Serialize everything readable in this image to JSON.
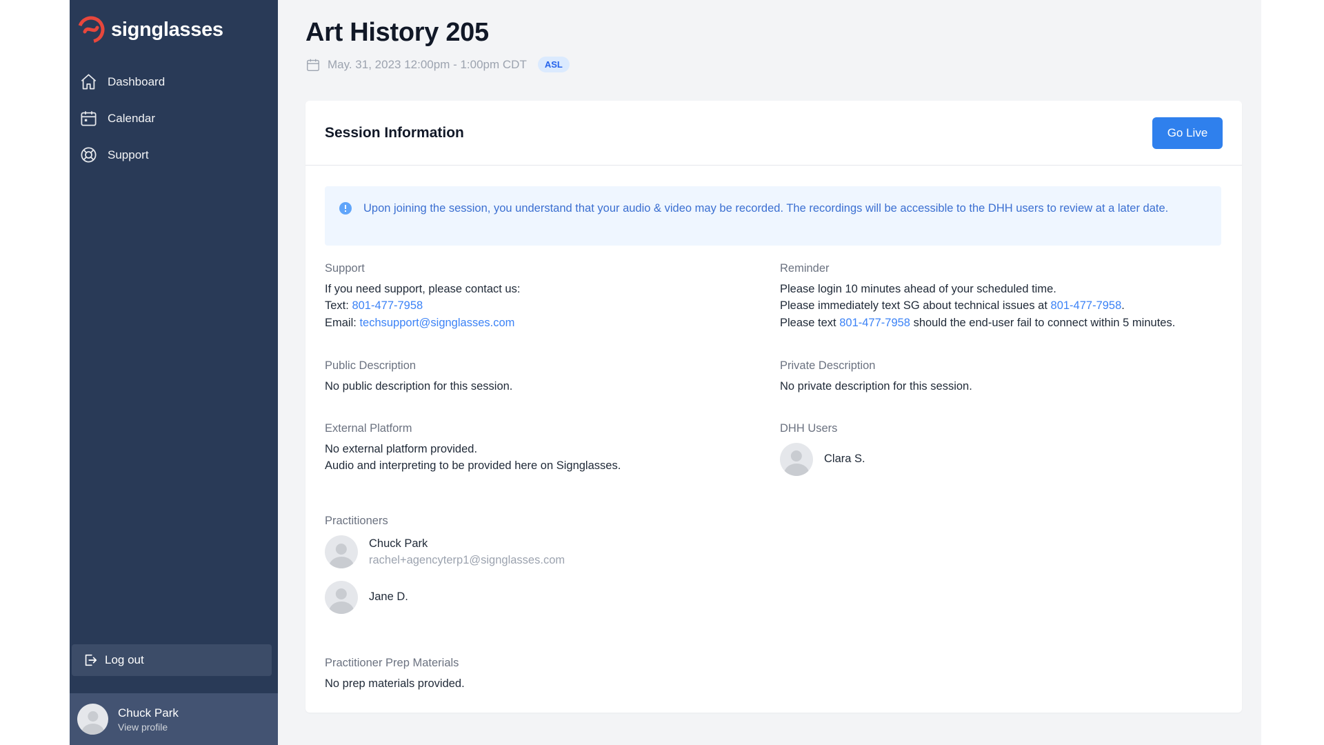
{
  "app": {
    "name": "signglasses",
    "brand_color": "#e8473c",
    "sidebar_color": "#293a57",
    "accent": "#2f80ed"
  },
  "sidebar": {
    "items": [
      {
        "label": "Dashboard",
        "icon": "home-icon"
      },
      {
        "label": "Calendar",
        "icon": "calendar-icon"
      },
      {
        "label": "Support",
        "icon": "lifebuoy-icon"
      }
    ],
    "logout_label": "Log out",
    "profile": {
      "name": "Chuck Park",
      "sub": "View profile"
    }
  },
  "page": {
    "title": "Art History 205",
    "datetime": "May. 31, 2023 12:00pm - 1:00pm CDT",
    "language_badge": "ASL"
  },
  "card": {
    "title": "Session Information",
    "go_live_label": "Go Live",
    "alert": "Upon joining the session, you understand that your audio & video may be recorded. The recordings will be accessible to the DHH users to review at a later date.",
    "support": {
      "label": "Support",
      "intro": "If you need support, please contact us:",
      "text_prefix": "Text: ",
      "phone": "801-477-7958",
      "email_prefix": "Email: ",
      "email": "techsupport@signglasses.com"
    },
    "reminder": {
      "label": "Reminder",
      "line1": "Please login 10 minutes ahead of your scheduled time.",
      "line2_prefix": "Please immediately text SG about technical issues at ",
      "line2_phone": "801-477-7958",
      "line2_suffix": ".",
      "line3_prefix": "Please text ",
      "line3_phone": "801-477-7958",
      "line3_suffix": " should the end-user fail to connect within 5 minutes."
    },
    "public_description": {
      "label": "Public Description",
      "text": "No public description for this session."
    },
    "private_description": {
      "label": "Private Description",
      "text": "No private description for this session."
    },
    "external_platform": {
      "label": "External Platform",
      "line1": "No external platform provided.",
      "line2": "Audio and interpreting to be provided here on Signglasses."
    },
    "dhh_users": {
      "label": "DHH Users",
      "users": [
        {
          "name": "Clara S."
        }
      ]
    },
    "practitioners": {
      "label": "Practitioners",
      "items": [
        {
          "name": "Chuck Park",
          "email": "rachel+agencyterp1@signglasses.com"
        },
        {
          "name": "Jane D."
        }
      ]
    },
    "prep_materials": {
      "label": "Practitioner Prep Materials",
      "text": "No prep materials provided."
    }
  }
}
